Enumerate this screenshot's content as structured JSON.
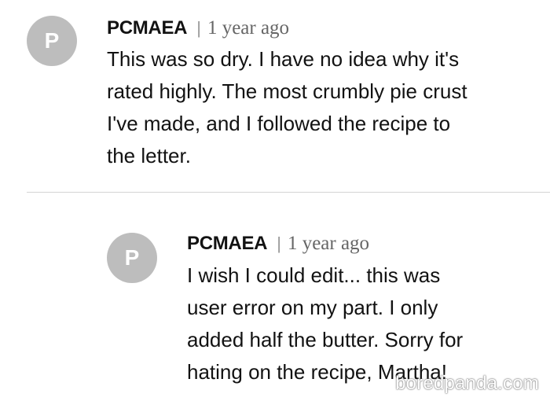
{
  "comments": [
    {
      "avatar_letter": "P",
      "author": "PCMAEA",
      "separator": "|",
      "timestamp": "1 year ago",
      "text": "This was so dry. I have no idea why it's\nrated highly. The most crumbly pie crust\nI've made, and I followed the recipe to\nthe letter."
    }
  ],
  "reply": {
    "avatar_letter": "P",
    "author": "PCMAEA",
    "separator": "|",
    "timestamp": "1 year ago",
    "text": "I wish I could edit... this was\nuser error on my part. I only\nadded half the butter. Sorry for\nhating on the recipe, Martha!"
  },
  "watermark": "boredpanda.com"
}
